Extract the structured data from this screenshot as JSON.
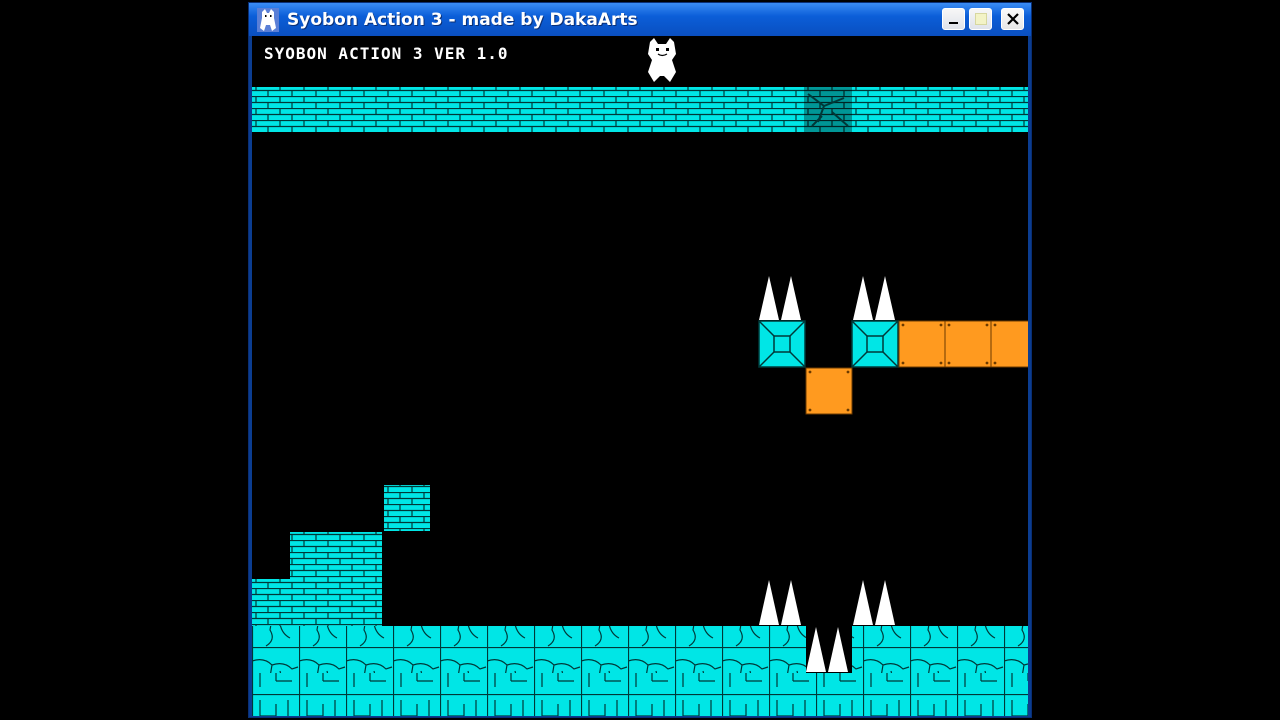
{
  "window": {
    "title": "Syobon Action 3 - made by DakaArts"
  },
  "game": {
    "hud_text": "SYOBON ACTION 3 VER 1.0"
  },
  "colors": {
    "brick": "#00e6e6",
    "ground": "#00e6e6",
    "mortar": "#003838",
    "orange_block": "#ff9a1f",
    "spike": "#ffffff",
    "background": "#000000",
    "titlebar": "#0b5ed8"
  },
  "icons": [
    "cat-app-icon",
    "minimize-icon",
    "maximize-icon",
    "close-icon"
  ]
}
